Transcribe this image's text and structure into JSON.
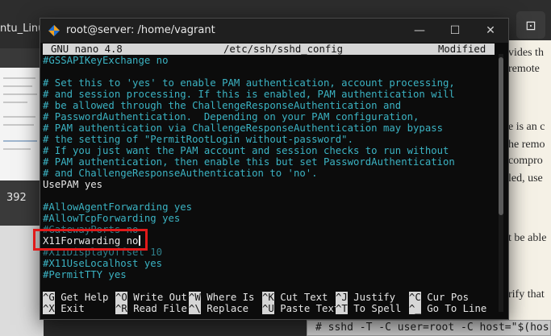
{
  "background": {
    "window_title": "ntu_Linu",
    "page_number": "392",
    "right_icon": "sidebar-toggle-icon",
    "right_icon_glyph": "⊡",
    "doc_lines": [
      "vides th",
      "remote",
      "e is an c",
      "he remo",
      "compro",
      "led, use",
      "t be able",
      "rify that"
    ],
    "code_snippet": "# sshd -T -C user=root -C host=\"$(hos"
  },
  "terminal": {
    "title": "root@server: /home/vagrant",
    "buttons": {
      "minimize": "—",
      "maximize": "☐",
      "close": "✕"
    },
    "header": {
      "version": "GNU nano 4.8",
      "filename": "/etc/ssh/sshd_config",
      "status": "Modified"
    },
    "lines": [
      "#GSSAPIKeyExchange no",
      "",
      "# Set this to 'yes' to enable PAM authentication, account processing,",
      "# and session processing. If this is enabled, PAM authentication will",
      "# be allowed through the ChallengeResponseAuthentication and",
      "# PasswordAuthentication.  Depending on your PAM configuration,",
      "# PAM authentication via ChallengeResponseAuthentication may bypass",
      "# the setting of \"PermitRootLogin without-password\".",
      "# If you just want the PAM account and session checks to run without",
      "# PAM authentication, then enable this but set PasswordAuthentication",
      "# and ChallengeResponseAuthentication to 'no'.",
      "UsePAM yes",
      "",
      "#AllowAgentForwarding yes",
      "#AllowTcpForwarding yes",
      "#GatewayPorts no",
      "X11Forwarding no",
      "#X11DisplayOffset 10",
      "#X11UseLocalhost yes",
      "#PermitTTY yes"
    ],
    "shortcuts_row1": [
      {
        "key": "^G",
        "label": "Get Help"
      },
      {
        "key": "^O",
        "label": "Write Out"
      },
      {
        "key": "^W",
        "label": "Where Is"
      },
      {
        "key": "^K",
        "label": "Cut Text"
      },
      {
        "key": "^J",
        "label": "Justify"
      },
      {
        "key": "^C",
        "label": "Cur Pos"
      }
    ],
    "shortcuts_row2": [
      {
        "key": "^X",
        "label": "Exit"
      },
      {
        "key": "^R",
        "label": "Read File"
      },
      {
        "key": "^\\",
        "label": "Replace"
      },
      {
        "key": "^U",
        "label": "Paste Text"
      },
      {
        "key": "^T",
        "label": "To Spell"
      },
      {
        "key": "^_",
        "label": "Go To Line"
      }
    ]
  },
  "colors": {
    "comment": "#3bb3c3",
    "highlight_box": "#e11a1a",
    "header_bg": "#d6d6d6"
  }
}
